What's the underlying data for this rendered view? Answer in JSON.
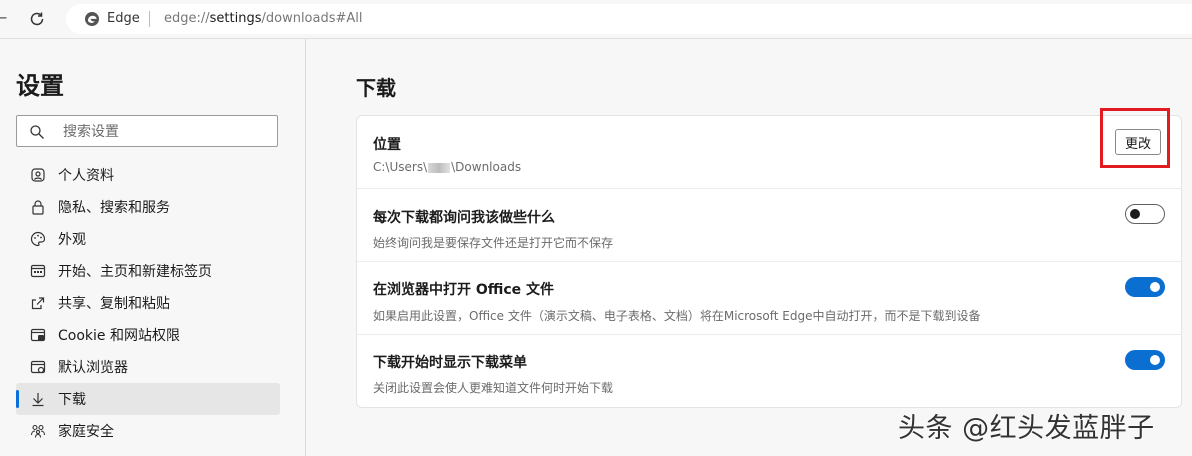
{
  "addressbar": {
    "browser_name": "Edge",
    "url_prefix": "edge://",
    "url_host": "settings",
    "url_path": "/downloads#All"
  },
  "sidebar": {
    "title": "设置",
    "search_placeholder": "搜索设置",
    "items": [
      {
        "label": "个人资料",
        "icon": "profile-icon"
      },
      {
        "label": "隐私、搜索和服务",
        "icon": "lock-icon"
      },
      {
        "label": "外观",
        "icon": "palette-icon"
      },
      {
        "label": "开始、主页和新建标签页",
        "icon": "new-tab-icon"
      },
      {
        "label": "共享、复制和粘贴",
        "icon": "share-icon"
      },
      {
        "label": "Cookie 和网站权限",
        "icon": "site-permissions-icon"
      },
      {
        "label": "默认浏览器",
        "icon": "browser-icon"
      },
      {
        "label": "下载",
        "icon": "download-icon",
        "active": true
      },
      {
        "label": "家庭安全",
        "icon": "family-icon"
      }
    ]
  },
  "main": {
    "section_title": "下载",
    "location": {
      "title": "位置",
      "path_prefix": "C:\\Users\\",
      "path_suffix": "\\Downloads",
      "change_button": "更改"
    },
    "settings": [
      {
        "title": "每次下载都询问我该做些什么",
        "desc": "始终询问我是要保存文件还是打开它而不保存",
        "enabled": false
      },
      {
        "title": "在浏览器中打开 Office 文件",
        "desc": "如果启用此设置，Office 文件（演示文稿、电子表格、文档）将在Microsoft Edge中自动打开，而不是下载到设备",
        "enabled": true
      },
      {
        "title": "下载开始时显示下载菜单",
        "desc": "关闭此设置会使人更难知道文件何时开始下载",
        "enabled": true
      }
    ]
  },
  "colors": {
    "accent": "#0b6fd1",
    "highlight_box": "#e21b23"
  },
  "watermark": "头条 @红头发蓝胖子"
}
